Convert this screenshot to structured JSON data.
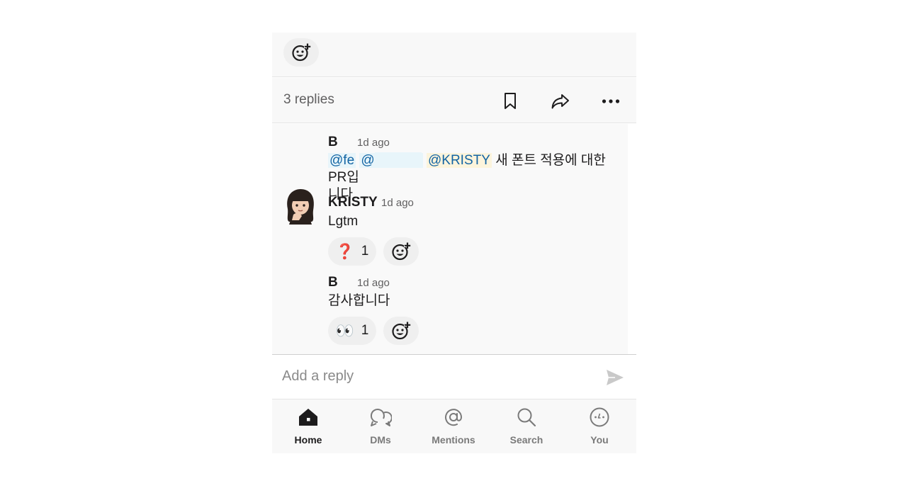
{
  "top_reaction": {
    "icon": "add-reaction-icon"
  },
  "replies_bar": {
    "count_label": "3 replies",
    "icons": [
      "bookmark-icon",
      "share-icon",
      "more-icon"
    ]
  },
  "messages": [
    {
      "author": "B",
      "time": "1d ago",
      "mention_1": "@fe",
      "mention_2": "@",
      "mention_3": "@KRISTY",
      "text_after": " 새 폰트 적용에 대한 PR입",
      "text_line2": "니다."
    },
    {
      "author": "KRISTY",
      "time": "1d ago",
      "text": "Lgtm",
      "reactions": [
        {
          "emoji": "❓",
          "count": "1"
        }
      ]
    },
    {
      "author": "B",
      "time": "1d ago",
      "text": "감사합니다",
      "reactions": [
        {
          "emoji": "👀",
          "count": "1"
        }
      ]
    }
  ],
  "composer": {
    "placeholder": "Add a reply"
  },
  "tabs": [
    {
      "label": "Home",
      "icon": "home-icon",
      "active": true
    },
    {
      "label": "DMs",
      "icon": "dms-icon",
      "active": false
    },
    {
      "label": "Mentions",
      "icon": "mentions-icon",
      "active": false
    },
    {
      "label": "Search",
      "icon": "search-icon",
      "active": false
    },
    {
      "label": "You",
      "icon": "you-icon",
      "active": false
    }
  ],
  "colors": {
    "mention_text": "#1264a3",
    "mention_bg": "#e8f5fa",
    "self_mention_bg": "#fcf4dc",
    "active_tab": "#1d1c1d",
    "inactive_tab": "#7a7a7a"
  }
}
